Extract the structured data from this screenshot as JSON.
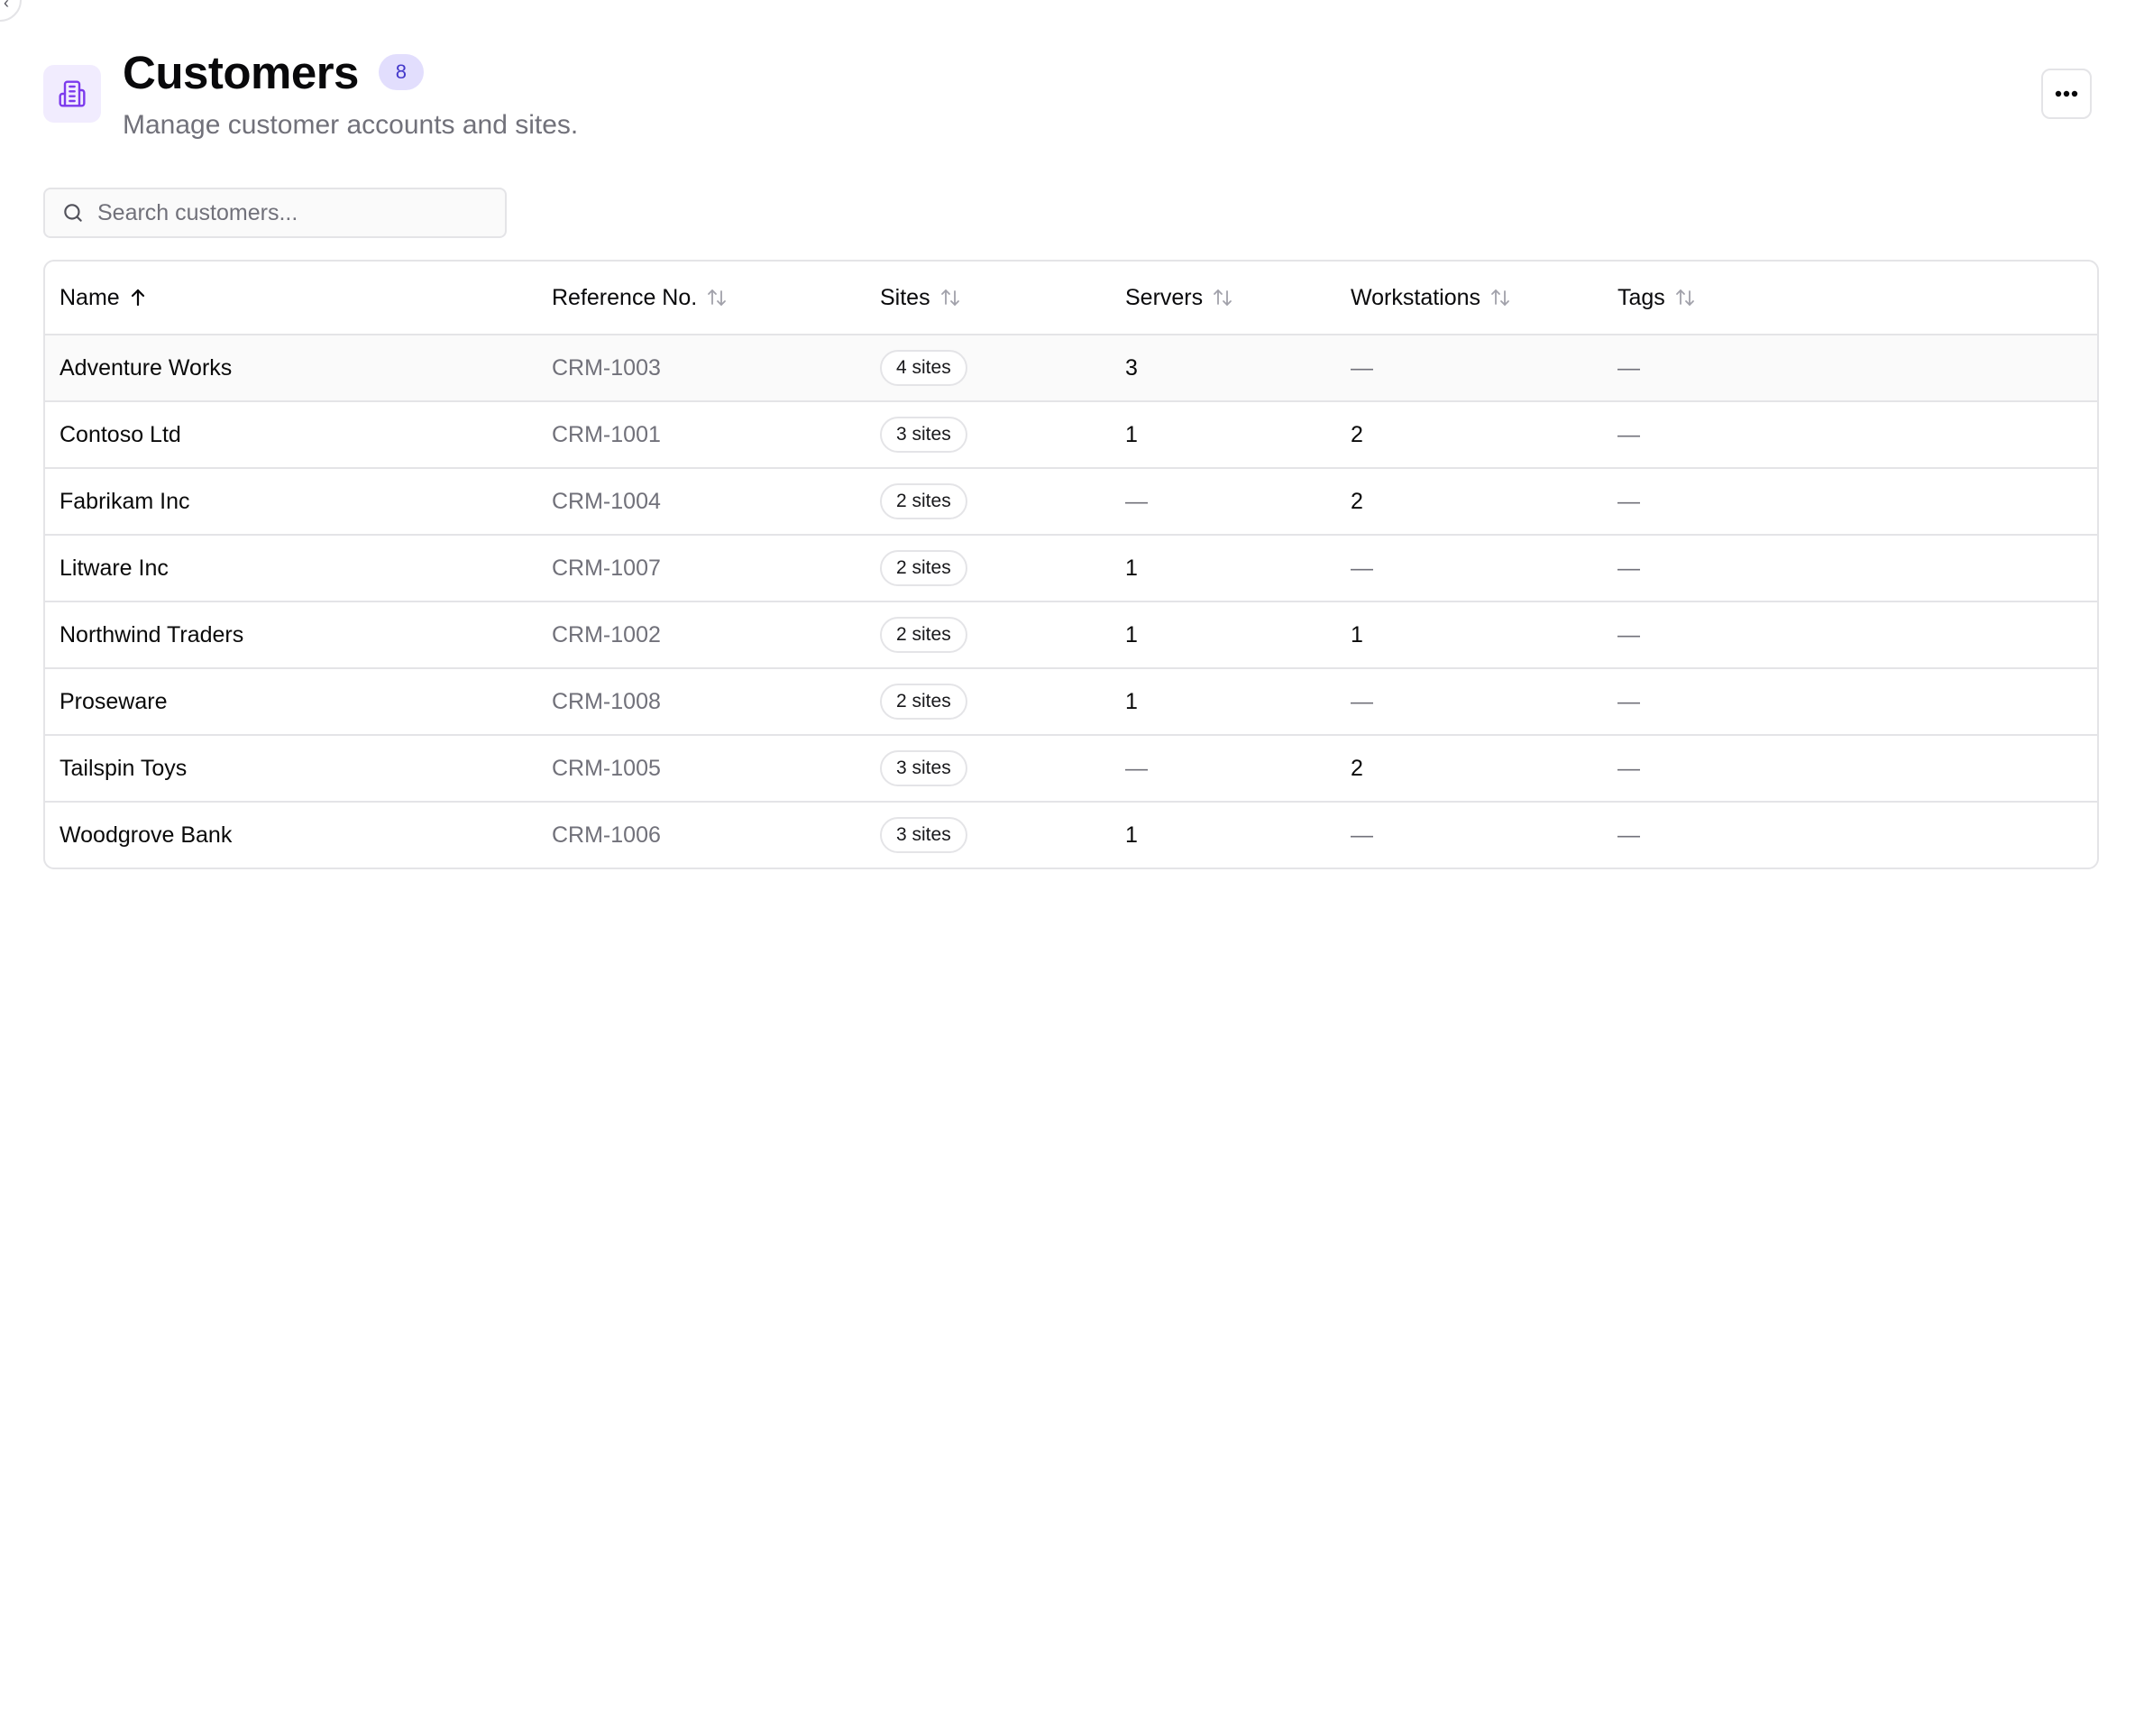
{
  "page": {
    "title": "Customers",
    "count": "8",
    "subtitle": "Manage customer accounts and sites.",
    "icon": "building-icon",
    "accent": "#7c3aed"
  },
  "search": {
    "placeholder": "Search customers..."
  },
  "table": {
    "columns": [
      "Name",
      "Reference No.",
      "Sites",
      "Servers",
      "Workstations",
      "Tags"
    ],
    "sort": {
      "column": "Name",
      "direction": "ascending"
    },
    "rows": [
      {
        "name": "Adventure Works",
        "ref": "CRM-1003",
        "sites": "4 sites",
        "servers": "3",
        "workstations": "—",
        "tags": "—"
      },
      {
        "name": "Contoso Ltd",
        "ref": "CRM-1001",
        "sites": "3 sites",
        "servers": "1",
        "workstations": "2",
        "tags": "—"
      },
      {
        "name": "Fabrikam Inc",
        "ref": "CRM-1004",
        "sites": "2 sites",
        "servers": "—",
        "workstations": "2",
        "tags": "—"
      },
      {
        "name": "Litware Inc",
        "ref": "CRM-1007",
        "sites": "2 sites",
        "servers": "1",
        "workstations": "—",
        "tags": "—"
      },
      {
        "name": "Northwind Traders",
        "ref": "CRM-1002",
        "sites": "2 sites",
        "servers": "1",
        "workstations": "1",
        "tags": "—"
      },
      {
        "name": "Proseware",
        "ref": "CRM-1008",
        "sites": "2 sites",
        "servers": "1",
        "workstations": "—",
        "tags": "—"
      },
      {
        "name": "Tailspin Toys",
        "ref": "CRM-1005",
        "sites": "3 sites",
        "servers": "—",
        "workstations": "2",
        "tags": "—"
      },
      {
        "name": "Woodgrove Bank",
        "ref": "CRM-1006",
        "sites": "3 sites",
        "servers": "1",
        "workstations": "—",
        "tags": "—"
      }
    ]
  }
}
